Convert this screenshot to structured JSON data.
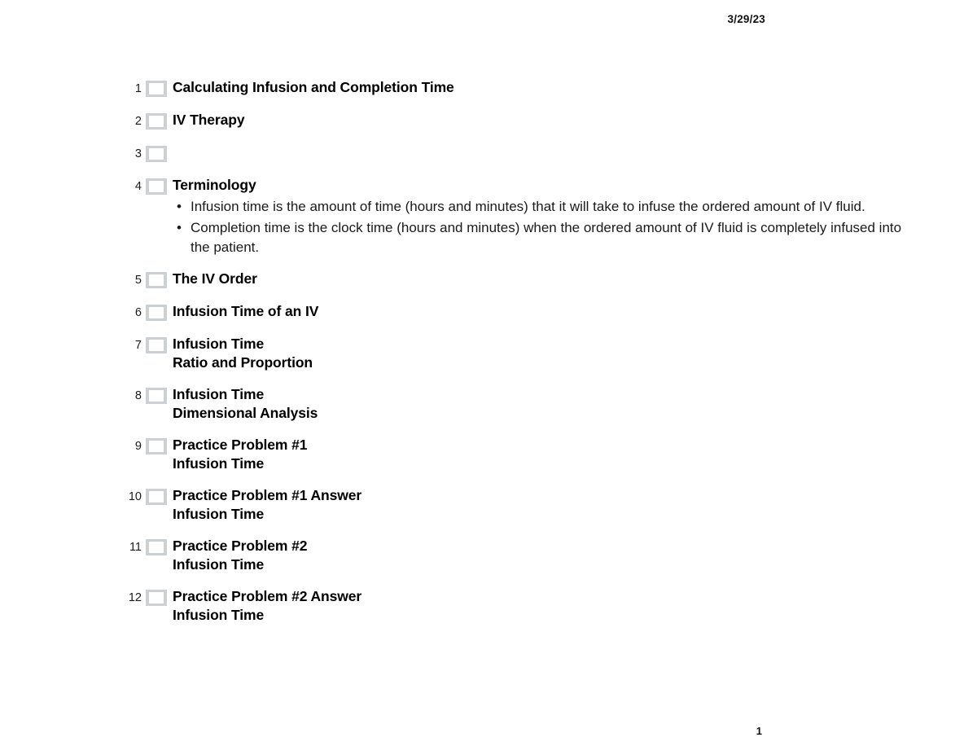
{
  "document": {
    "header_date": "3/29/23",
    "page_number": "1",
    "slide_icon_name": "slide-thumbnail-icon",
    "bullet_glyph": "•",
    "colors": {
      "text": "#000000",
      "slide_icon_fill": "#ccd1d6",
      "slide_icon_inner": "#ffffff",
      "page_background": "#ffffff"
    }
  },
  "outline": {
    "slides": [
      {
        "number": "1",
        "title": "Calculating Infusion and Completion Time",
        "bullets": []
      },
      {
        "number": "2",
        "title": "IV Therapy",
        "bullets": []
      },
      {
        "number": "3",
        "title": "",
        "bullets": []
      },
      {
        "number": "4",
        "title": "Terminology",
        "bullets": [
          "Infusion time is the amount of time (hours and minutes) that it will take to infuse the ordered amount of IV fluid.",
          "Completion time is the clock time (hours and minutes) when the ordered amount of IV fluid is completely infused into the patient."
        ]
      },
      {
        "number": "5",
        "title": "The IV Order",
        "bullets": []
      },
      {
        "number": "6",
        "title": "Infusion Time of an IV",
        "bullets": []
      },
      {
        "number": "7",
        "title": "Infusion Time\nRatio and Proportion",
        "bullets": []
      },
      {
        "number": "8",
        "title": "Infusion Time\nDimensional Analysis",
        "bullets": []
      },
      {
        "number": "9",
        "title": "Practice Problem #1\nInfusion Time",
        "bullets": []
      },
      {
        "number": "10",
        "title": "Practice Problem #1 Answer\nInfusion Time",
        "bullets": []
      },
      {
        "number": "11",
        "title": "Practice Problem #2\nInfusion Time",
        "bullets": []
      },
      {
        "number": "12",
        "title": "Practice Problem #2 Answer\nInfusion Time",
        "bullets": []
      }
    ]
  }
}
